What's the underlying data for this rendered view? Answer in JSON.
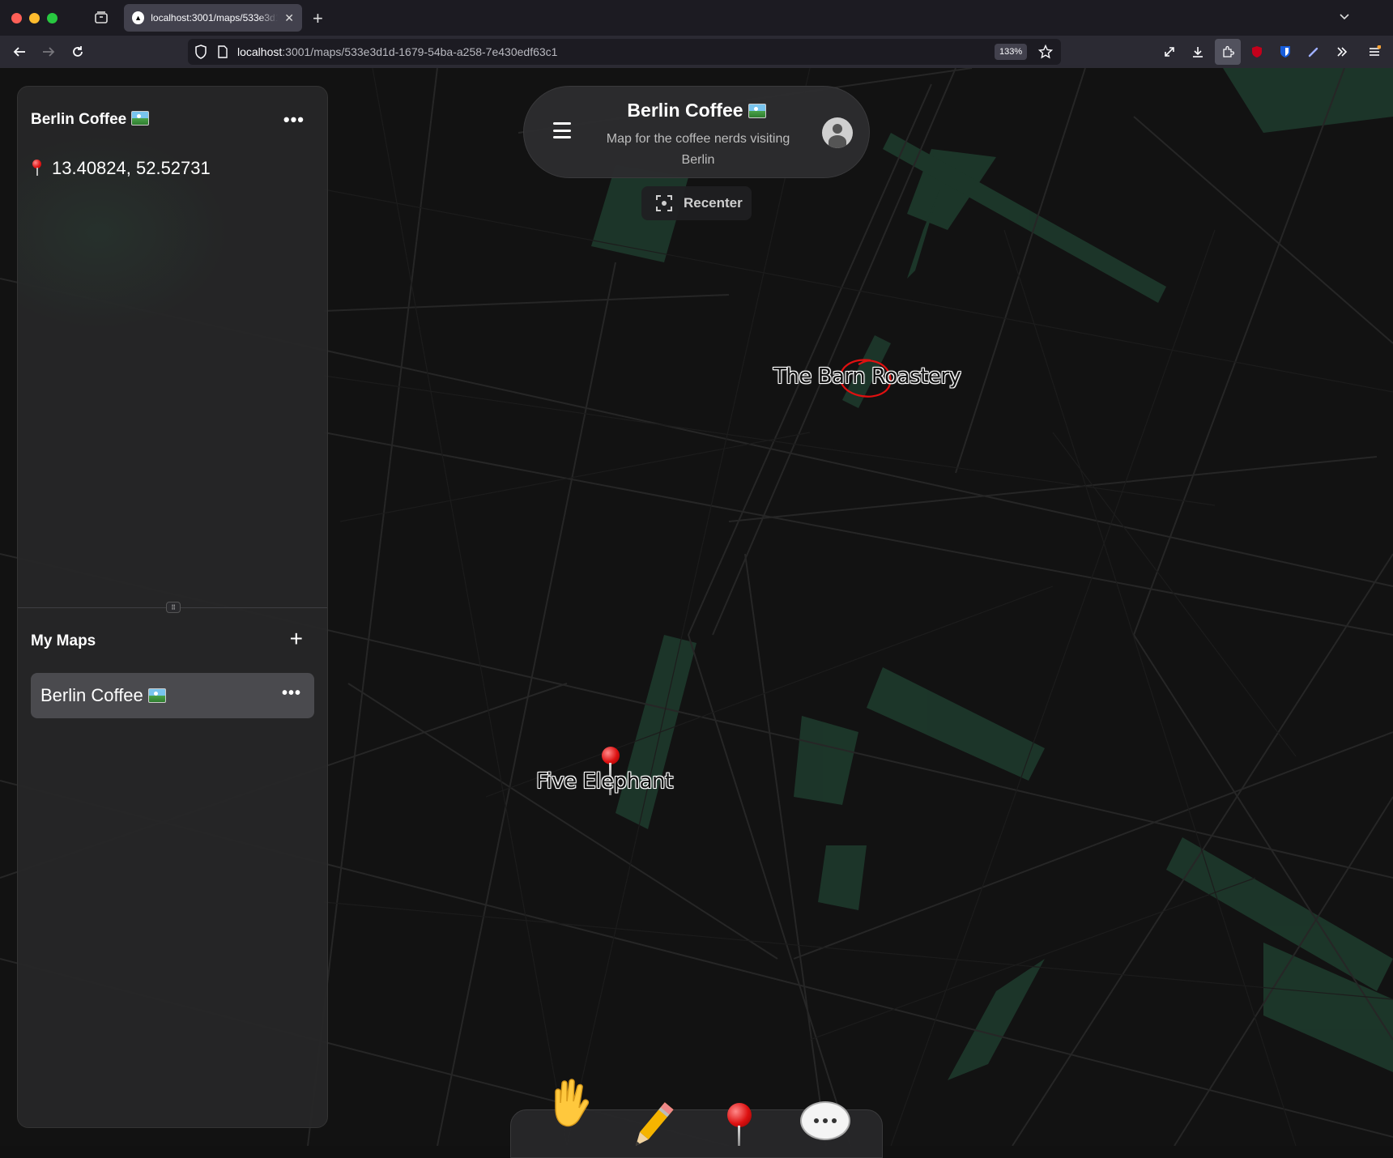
{
  "browser": {
    "tab_title": "localhost:3001/maps/533e3d1d-1679-54ba-a258-7e430edf63c1",
    "url_host": "localhost",
    "url_rest": ":3001/maps/533e3d1d-1679-54ba-a258-7e430edf63c1",
    "zoom": "133%"
  },
  "sidebar": {
    "title": "Berlin Coffee",
    "more_label": "•••",
    "coordinates": "13.40824, 52.52731",
    "my_maps_title": "My Maps",
    "add_label": "+",
    "maps": [
      {
        "label": "Berlin Coffee",
        "more_label": "•••"
      }
    ]
  },
  "header": {
    "title": "Berlin Coffee",
    "subtitle": "Map for the coffee nerds visiting Berlin"
  },
  "recenter_label": "Recenter",
  "map": {
    "labels": [
      {
        "text": "The Barn Roastery"
      },
      {
        "text": "Five Elephant"
      }
    ],
    "annotation_color": "#e01010"
  },
  "toolbar": {
    "tools": [
      "hand-icon",
      "pencil-icon",
      "pin-icon",
      "comment-icon"
    ]
  },
  "colors": {
    "map_background": "#121212",
    "park": "#1e3a2c",
    "panel": "#262628"
  }
}
